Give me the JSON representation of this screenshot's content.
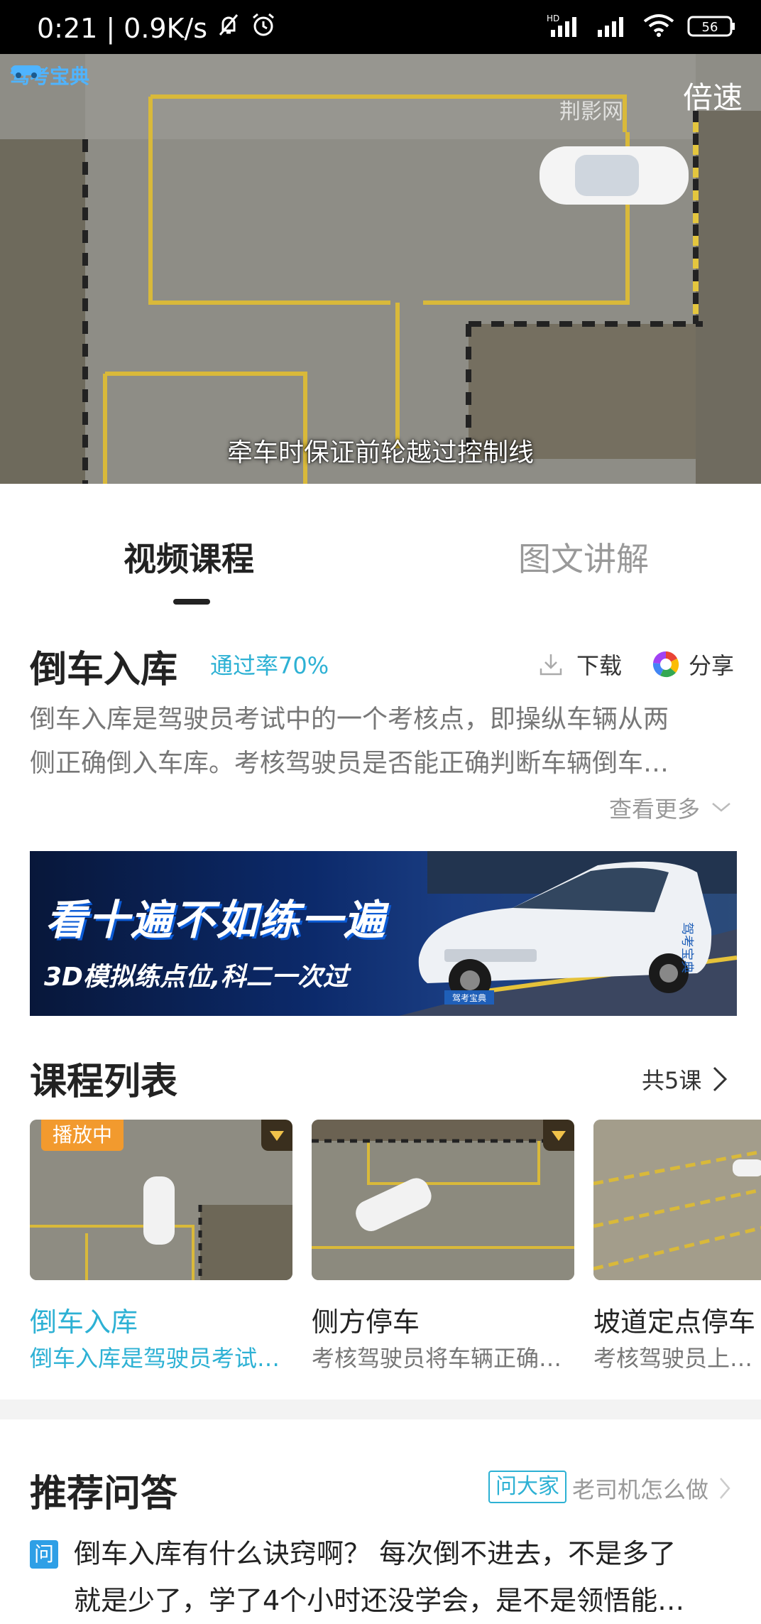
{
  "status_bar": {
    "time": "0:21",
    "speed": "0.9K/s",
    "network": "HD",
    "battery": "56"
  },
  "video": {
    "speed_button": "倍速",
    "watermark_logo": "驾考宝典",
    "watermark_right": "荆影网",
    "subtitle": "牵车时保证前轮越过控制线"
  },
  "tabs": [
    {
      "label": "视频课程"
    },
    {
      "label": "图文讲解"
    }
  ],
  "lesson": {
    "title": "倒车入库",
    "pass_rate": "通过率70%",
    "download_label": "下载",
    "share_label": "分享",
    "description_line1": "倒车入库是驾驶员考试中的一个考核点，即操纵车辆从两",
    "description_line2": "侧正确倒入车库。考核驾驶员是否能正确判断车辆倒车…",
    "more_label": "查看更多"
  },
  "banner": {
    "headline": "看十遍不如练一遍",
    "subline": "3D模拟练点位,科二一次过",
    "car_badge": "驾考宝典",
    "car_door_text": "驾考宝典"
  },
  "course_list": {
    "title": "课程列表",
    "count": "共5课",
    "playing_tag": "播放中",
    "items": [
      {
        "title": "倒车入库",
        "subtitle": "倒车入库是驾驶员考试…"
      },
      {
        "title": "侧方停车",
        "subtitle": "考核驾驶员将车辆正确…"
      },
      {
        "title": "坡道定点停车",
        "subtitle": "考核驾驶员上坡时…"
      }
    ]
  },
  "qa": {
    "title": "推荐问答",
    "ask_tag": "问大家",
    "ask_text": "老司机怎么做",
    "question_icon": "问",
    "question_line1": "倒车入库有什么诀窍啊？ 每次倒不进去，不是多了",
    "question_line2": "就是少了，学了4个小时还没学会，是不是领悟能…"
  },
  "colors": {
    "accent": "#2db1d4",
    "playing_tag": "#f29a2e",
    "question_icon": "#2e9fe6"
  }
}
